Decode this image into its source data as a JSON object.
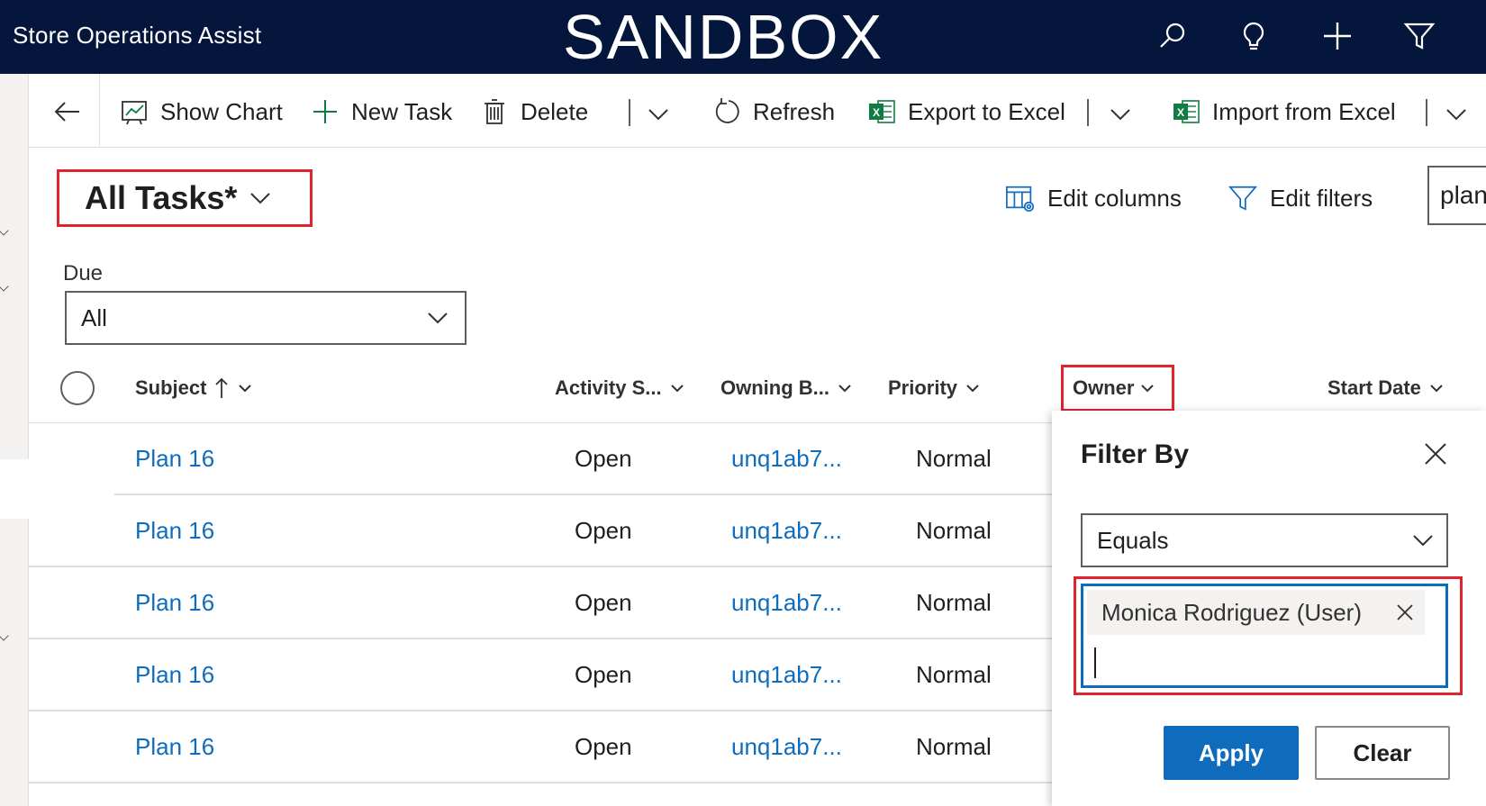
{
  "header": {
    "app_title": "Store Operations Assist",
    "environment_label": "SANDBOX",
    "icons": [
      "search-icon",
      "lightbulb-icon",
      "plus-icon",
      "filter-icon"
    ]
  },
  "commandbar": {
    "show_chart": "Show Chart",
    "new_task": "New Task",
    "delete": "Delete",
    "refresh": "Refresh",
    "export_excel": "Export to Excel",
    "import_excel": "Import from Excel"
  },
  "view": {
    "title": "All Tasks*",
    "edit_columns": "Edit columns",
    "edit_filters": "Edit filters",
    "search_value": "plan"
  },
  "due_filter": {
    "label": "Due",
    "value": "All"
  },
  "grid": {
    "columns": {
      "subject": "Subject",
      "activity_status": "Activity S...",
      "owning_business": "Owning B...",
      "priority": "Priority",
      "owner": "Owner",
      "start_date": "Start Date"
    },
    "rows": [
      {
        "subject": "Plan 16",
        "status": "Open",
        "owning": "unq1ab7...",
        "priority": "Normal"
      },
      {
        "subject": "Plan 16",
        "status": "Open",
        "owning": "unq1ab7...",
        "priority": "Normal"
      },
      {
        "subject": "Plan 16",
        "status": "Open",
        "owning": "unq1ab7...",
        "priority": "Normal"
      },
      {
        "subject": "Plan 16",
        "status": "Open",
        "owning": "unq1ab7...",
        "priority": "Normal"
      },
      {
        "subject": "Plan 16",
        "status": "Open",
        "owning": "unq1ab7...",
        "priority": "Normal"
      }
    ]
  },
  "filter_panel": {
    "title": "Filter By",
    "operator": "Equals",
    "selected_value": "Monica Rodriguez (User)",
    "apply": "Apply",
    "clear": "Clear"
  },
  "colors": {
    "header_bg": "#04163c",
    "link": "#0f6cbd",
    "highlight": "#e0232e",
    "primary": "#0f6cbd"
  }
}
